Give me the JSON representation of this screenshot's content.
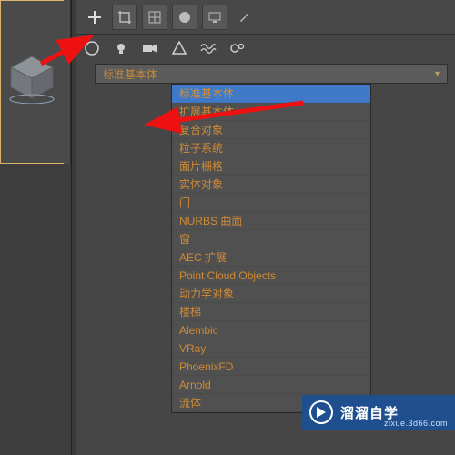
{
  "toolbar": {
    "icons": [
      "plus-icon",
      "crop-icon",
      "grid-icon",
      "circle-fill-icon",
      "monitor-icon",
      "wrench-icon"
    ]
  },
  "create_row": {
    "icons": [
      "sphere-icon",
      "light-icon",
      "camera-icon",
      "spline-icon",
      "waves-icon",
      "gears-icon"
    ]
  },
  "dropdown": {
    "label": "标准基本体"
  },
  "categories": [
    "标准基本体",
    "扩展基本体",
    "复合对象",
    "粒子系统",
    "面片栅格",
    "实体对象",
    "门",
    "NURBS 曲面",
    "窗",
    "AEC 扩展",
    "Point Cloud Objects",
    "动力学对象",
    "楼梯",
    "Alembic",
    "VRay",
    "PhoenixFD",
    "Arnold",
    "流体"
  ],
  "selected_index": 0,
  "watermark": {
    "brand": "溜溜自学",
    "url": "zixue.3d66.com"
  }
}
